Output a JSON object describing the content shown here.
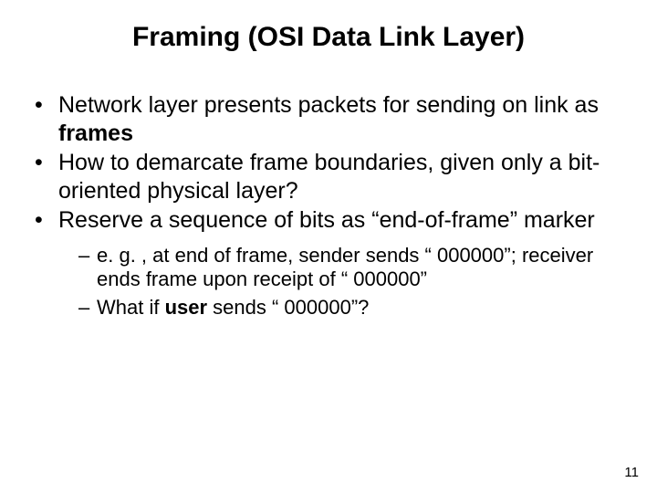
{
  "title": "Framing (OSI Data Link Layer)",
  "bullets": {
    "b1a": "Network layer presents packets for sending on link as ",
    "b1b": "frames",
    "b2": "How to demarcate frame boundaries, given only a bit-oriented physical layer?",
    "b3": "Reserve a sequence of bits as “end-of-frame” marker",
    "s1": "e. g. , at end of frame, sender sends “ 000000”; receiver ends frame upon receipt of “ 000000”",
    "s2a": "What if ",
    "s2b": "user",
    "s2c": " sends “ 000000”?"
  },
  "page_number": "11"
}
